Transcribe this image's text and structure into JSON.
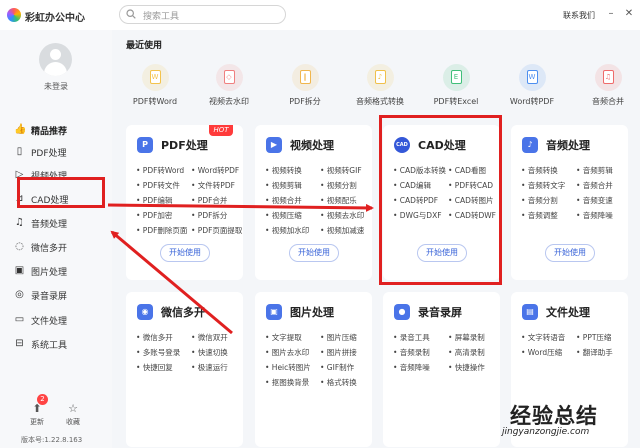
{
  "app": {
    "title": "彩虹办公中心",
    "contact": "联系我们"
  },
  "search": {
    "placeholder": "搜索工具"
  },
  "user": {
    "login": "未登录"
  },
  "sidebar": {
    "items": [
      {
        "label": "精品推荐",
        "icon": "thumb-up-icon"
      },
      {
        "label": "PDF处理",
        "icon": "pdf-icon"
      },
      {
        "label": "视频处理",
        "icon": "video-icon"
      },
      {
        "label": "CAD处理",
        "icon": "cad-icon"
      },
      {
        "label": "音频处理",
        "icon": "music-icon"
      },
      {
        "label": "微信多开",
        "icon": "wechat-icon"
      },
      {
        "label": "图片处理",
        "icon": "image-icon"
      },
      {
        "label": "录音录屏",
        "icon": "record-icon"
      },
      {
        "label": "文件处理",
        "icon": "folder-icon"
      },
      {
        "label": "系统工具",
        "icon": "system-icon"
      }
    ],
    "footer": {
      "update": "更新",
      "update_badge": "2",
      "collect": "收藏",
      "version": "版本号:1.22.8.163"
    }
  },
  "recent": {
    "title": "最近使用",
    "items": [
      {
        "label": "PDF转Word",
        "color": "#f3c34c",
        "glyph": "W"
      },
      {
        "label": "视频去水印",
        "color": "#f07f7f",
        "glyph": "◇"
      },
      {
        "label": "PDF拆分",
        "color": "#f0b64d",
        "glyph": "‖"
      },
      {
        "label": "音频格式转换",
        "color": "#f0c04a",
        "glyph": "♪"
      },
      {
        "label": "PDF转Excel",
        "color": "#3fbf79",
        "glyph": "E"
      },
      {
        "label": "Word转PDF",
        "color": "#4d8ff0",
        "glyph": "W"
      },
      {
        "label": "音频合并",
        "color": "#ef6b6b",
        "glyph": "♫"
      }
    ]
  },
  "cards": [
    {
      "title": "PDF处理",
      "icon": "pdf-icon",
      "color": "#4a74e8",
      "glyph": "P",
      "hot": "HOT",
      "button": "开始使用",
      "items": [
        "PDF转Word",
        "Word转PDF",
        "PDF转文件",
        "文件转PDF",
        "PDF编辑",
        "PDF合并",
        "PDF加密",
        "PDF拆分",
        "PDF删除页面",
        "PDF页面提取"
      ]
    },
    {
      "title": "视频处理",
      "icon": "video-icon",
      "color": "#4a74e8",
      "glyph": "▶",
      "button": "开始使用",
      "items": [
        "视频转换",
        "视频转GIF",
        "视频剪辑",
        "视频分割",
        "视频合并",
        "视频配乐",
        "视频压缩",
        "视频去水印",
        "视频加水印",
        "视频加减速"
      ]
    },
    {
      "title": "CAD处理",
      "icon": "cad-icon",
      "color": "#3458d8",
      "glyph": "CAD",
      "button": "开始使用",
      "items": [
        "CAD版本转换",
        "CAD看图",
        "CAD编辑",
        "PDF转CAD",
        "CAD转PDF",
        "CAD转图片",
        "DWG与DXF",
        "CAD转DWF"
      ]
    },
    {
      "title": "音频处理",
      "icon": "music-icon",
      "color": "#4a74e8",
      "glyph": "♪",
      "button": "开始使用",
      "items": [
        "音频转换",
        "音频剪辑",
        "音频转文字",
        "音频合并",
        "音频分割",
        "音频变速",
        "音频调整",
        "音频降噪"
      ]
    },
    {
      "title": "微信多开",
      "icon": "wechat-icon",
      "color": "#4a74e8",
      "glyph": "◉",
      "button": "开始使用",
      "items": [
        "微信多开",
        "微信双开",
        "多账号登录",
        "快速切换",
        "快捷回复",
        "极速运行"
      ]
    },
    {
      "title": "图片处理",
      "icon": "image-icon",
      "color": "#4a74e8",
      "glyph": "▣",
      "button": "开始使用",
      "items": [
        "文字提取",
        "图片压缩",
        "图片去水印",
        "图片拼接",
        "Heic转图片",
        "GIF制作",
        "抠图换背景",
        "格式转换"
      ]
    },
    {
      "title": "录音录屏",
      "icon": "record-icon",
      "color": "#4a74e8",
      "glyph": "●",
      "button": "开始使用",
      "items": [
        "录音工具",
        "屏幕录制",
        "音频录制",
        "高清录制",
        "音频降噪",
        "快捷操作"
      ]
    },
    {
      "title": "文件处理",
      "icon": "folder-icon",
      "color": "#4a74e8",
      "glyph": "▤",
      "button": "开始使用",
      "items": [
        "文字转语音",
        "PPT压缩",
        "Word压缩",
        "翻译助手"
      ]
    }
  ],
  "watermark": {
    "brand": "经验总结",
    "url": "jingyanzongjie.com"
  }
}
